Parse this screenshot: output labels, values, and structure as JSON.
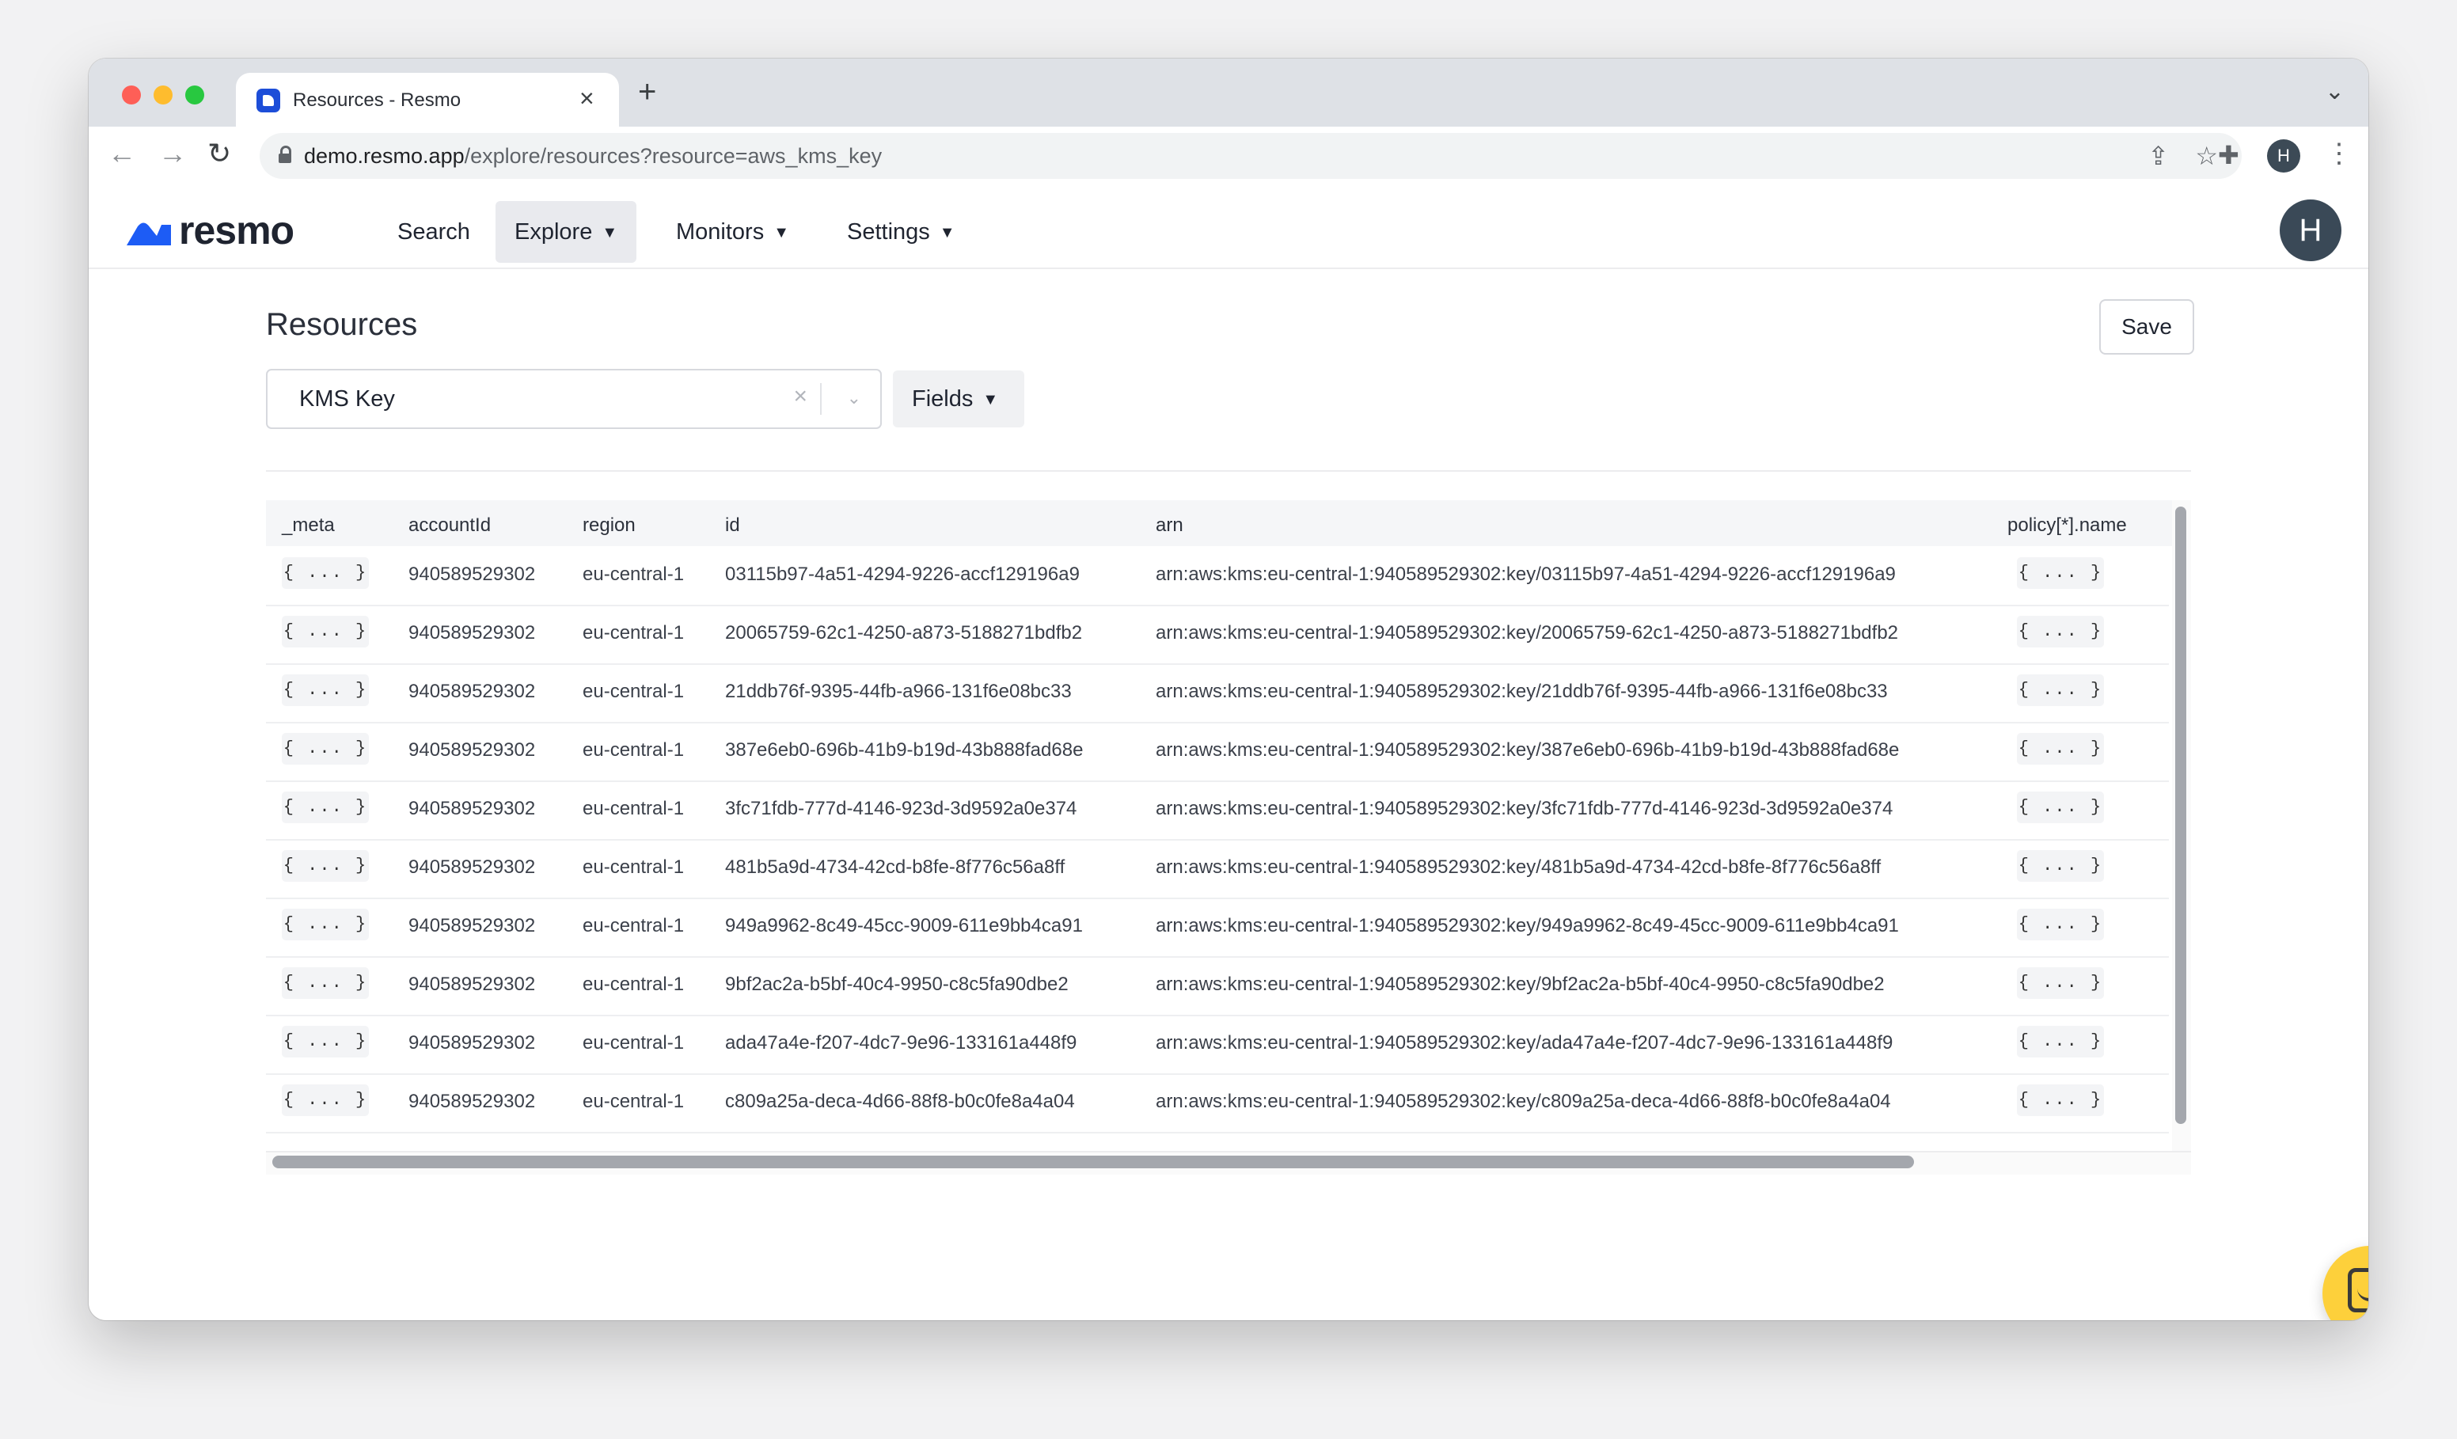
{
  "browser": {
    "tab_title": "Resources - Resmo",
    "tab_close": "×",
    "new_tab": "+",
    "url_host": "demo.resmo.app",
    "url_path": "/explore/resources?resource=aws_kms_key",
    "profile_initial": "H",
    "icons": [
      "back-icon",
      "forward-icon",
      "reload-icon",
      "lock-icon",
      "share-icon",
      "star-icon",
      "extensions-icon",
      "more-icon",
      "tab-list-icon"
    ]
  },
  "app": {
    "logo_text": "resmo",
    "brand_color": "#1d5cf5",
    "nav": [
      {
        "label": "Search",
        "has_dropdown": false,
        "active": false
      },
      {
        "label": "Explore",
        "has_dropdown": true,
        "active": true
      },
      {
        "label": "Monitors",
        "has_dropdown": true,
        "active": false
      },
      {
        "label": "Settings",
        "has_dropdown": true,
        "active": false
      }
    ],
    "avatar_initial": "H"
  },
  "page": {
    "title": "Resources",
    "save_label": "Save",
    "resource_select_value": "KMS Key",
    "fields_label": "Fields"
  },
  "table": {
    "columns": [
      "_meta",
      "accountId",
      "region",
      "id",
      "arn",
      "policy[*].name"
    ],
    "rows": [
      {
        "meta": "{ ... }",
        "accountId": "940589529302",
        "region": "eu-central-1",
        "id": "03115b97-4a51-4294-9226-accf129196a9",
        "arn": "arn:aws:kms:eu-central-1:940589529302:key/03115b97-4a51-4294-9226-accf129196a9",
        "policy": "{ ... }"
      },
      {
        "meta": "{ ... }",
        "accountId": "940589529302",
        "region": "eu-central-1",
        "id": "20065759-62c1-4250-a873-5188271bdfb2",
        "arn": "arn:aws:kms:eu-central-1:940589529302:key/20065759-62c1-4250-a873-5188271bdfb2",
        "policy": "{ ... }"
      },
      {
        "meta": "{ ... }",
        "accountId": "940589529302",
        "region": "eu-central-1",
        "id": "21ddb76f-9395-44fb-a966-131f6e08bc33",
        "arn": "arn:aws:kms:eu-central-1:940589529302:key/21ddb76f-9395-44fb-a966-131f6e08bc33",
        "policy": "{ ... }"
      },
      {
        "meta": "{ ... }",
        "accountId": "940589529302",
        "region": "eu-central-1",
        "id": "387e6eb0-696b-41b9-b19d-43b888fad68e",
        "arn": "arn:aws:kms:eu-central-1:940589529302:key/387e6eb0-696b-41b9-b19d-43b888fad68e",
        "policy": "{ ... }"
      },
      {
        "meta": "{ ... }",
        "accountId": "940589529302",
        "region": "eu-central-1",
        "id": "3fc71fdb-777d-4146-923d-3d9592a0e374",
        "arn": "arn:aws:kms:eu-central-1:940589529302:key/3fc71fdb-777d-4146-923d-3d9592a0e374",
        "policy": "{ ... }"
      },
      {
        "meta": "{ ... }",
        "accountId": "940589529302",
        "region": "eu-central-1",
        "id": "481b5a9d-4734-42cd-b8fe-8f776c56a8ff",
        "arn": "arn:aws:kms:eu-central-1:940589529302:key/481b5a9d-4734-42cd-b8fe-8f776c56a8ff",
        "policy": "{ ... }"
      },
      {
        "meta": "{ ... }",
        "accountId": "940589529302",
        "region": "eu-central-1",
        "id": "949a9962-8c49-45cc-9009-611e9bb4ca91",
        "arn": "arn:aws:kms:eu-central-1:940589529302:key/949a9962-8c49-45cc-9009-611e9bb4ca91",
        "policy": "{ ... }"
      },
      {
        "meta": "{ ... }",
        "accountId": "940589529302",
        "region": "eu-central-1",
        "id": "9bf2ac2a-b5bf-40c4-9950-c8c5fa90dbe2",
        "arn": "arn:aws:kms:eu-central-1:940589529302:key/9bf2ac2a-b5bf-40c4-9950-c8c5fa90dbe2",
        "policy": "{ ... }"
      },
      {
        "meta": "{ ... }",
        "accountId": "940589529302",
        "region": "eu-central-1",
        "id": "ada47a4e-f207-4dc7-9e96-133161a448f9",
        "arn": "arn:aws:kms:eu-central-1:940589529302:key/ada47a4e-f207-4dc7-9e96-133161a448f9",
        "policy": "{ ... }"
      },
      {
        "meta": "{ ... }",
        "accountId": "940589529302",
        "region": "eu-central-1",
        "id": "c809a25a-deca-4d66-88f8-b0c0fe8a4a04",
        "arn": "arn:aws:kms:eu-central-1:940589529302:key/c809a25a-deca-4d66-88f8-b0c0fe8a4a04",
        "policy": "{ ... }"
      }
    ]
  },
  "chat": {
    "icon": "chat-icon",
    "color": "#fdd03b"
  }
}
